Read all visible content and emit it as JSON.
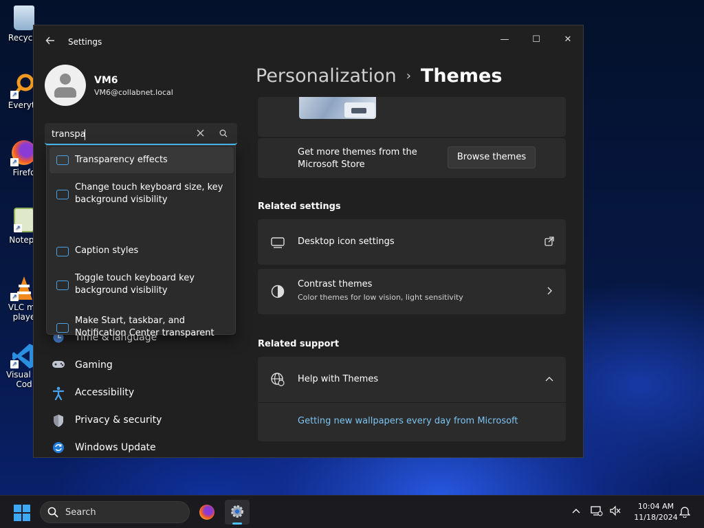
{
  "desktop": {
    "icons": [
      {
        "label": "Recycle",
        "icon": "recycle-bin-icon"
      },
      {
        "label": "Everyth",
        "icon": "everything-search-icon"
      },
      {
        "label": "Firefo",
        "icon": "firefox-icon"
      },
      {
        "label": "Notepa",
        "icon": "notepad-icon"
      },
      {
        "label": "VLC me",
        "label2": "playe",
        "icon": "vlc-icon"
      },
      {
        "label": "Visual St",
        "label2": "Cod",
        "icon": "vscode-icon"
      }
    ]
  },
  "window": {
    "title": "Settings",
    "controls": {
      "minimize": "—",
      "maximize": "☐",
      "close": "✕"
    }
  },
  "user": {
    "name": "VM6",
    "email": "VM6@collabnet.local"
  },
  "search": {
    "value": "transpa",
    "suggestions": [
      {
        "line1": "Transparency effects",
        "line2": ""
      },
      {
        "line1": "Change touch keyboard size, key",
        "line2": "background visibility"
      },
      {
        "line1": "Caption styles",
        "line2": ""
      },
      {
        "line1": "Toggle touch keyboard key",
        "line2": "background visibility"
      },
      {
        "line1": "Make Start, taskbar, and",
        "line2": "Notification Center transparent"
      }
    ]
  },
  "nav": {
    "items": [
      {
        "label": "Time & language",
        "icon": "clock-globe-icon"
      },
      {
        "label": "Gaming",
        "icon": "gamepad-icon"
      },
      {
        "label": "Accessibility",
        "icon": "accessibility-icon"
      },
      {
        "label": "Privacy & security",
        "icon": "shield-icon"
      },
      {
        "label": "Windows Update",
        "icon": "sync-icon"
      }
    ]
  },
  "breadcrumb": {
    "parent": "Personalization",
    "separator": "›",
    "current": "Themes"
  },
  "content": {
    "store_card": {
      "text_line1": "Get more themes from the",
      "text_line2": "Microsoft Store",
      "button": "Browse themes"
    },
    "related_settings": {
      "heading": "Related settings",
      "items": [
        {
          "title": "Desktop icon settings",
          "subtitle": "",
          "icon": "monitor-icon",
          "action_icon": "external-link-icon"
        },
        {
          "title": "Contrast themes",
          "subtitle": "Color themes for low vision, light sensitivity",
          "icon": "contrast-icon",
          "action_icon": "chevron-right-icon"
        }
      ]
    },
    "related_support": {
      "heading": "Related support",
      "item": {
        "title": "Help with Themes",
        "icon": "globe-icon",
        "action_icon": "chevron-up-icon"
      },
      "link": "Getting new wallpapers every day from Microsoft"
    }
  },
  "taskbar": {
    "search_placeholder": "Search",
    "clock": {
      "time": "10:04 AM",
      "date": "11/18/2024"
    },
    "accent": "#4cc2ff"
  }
}
